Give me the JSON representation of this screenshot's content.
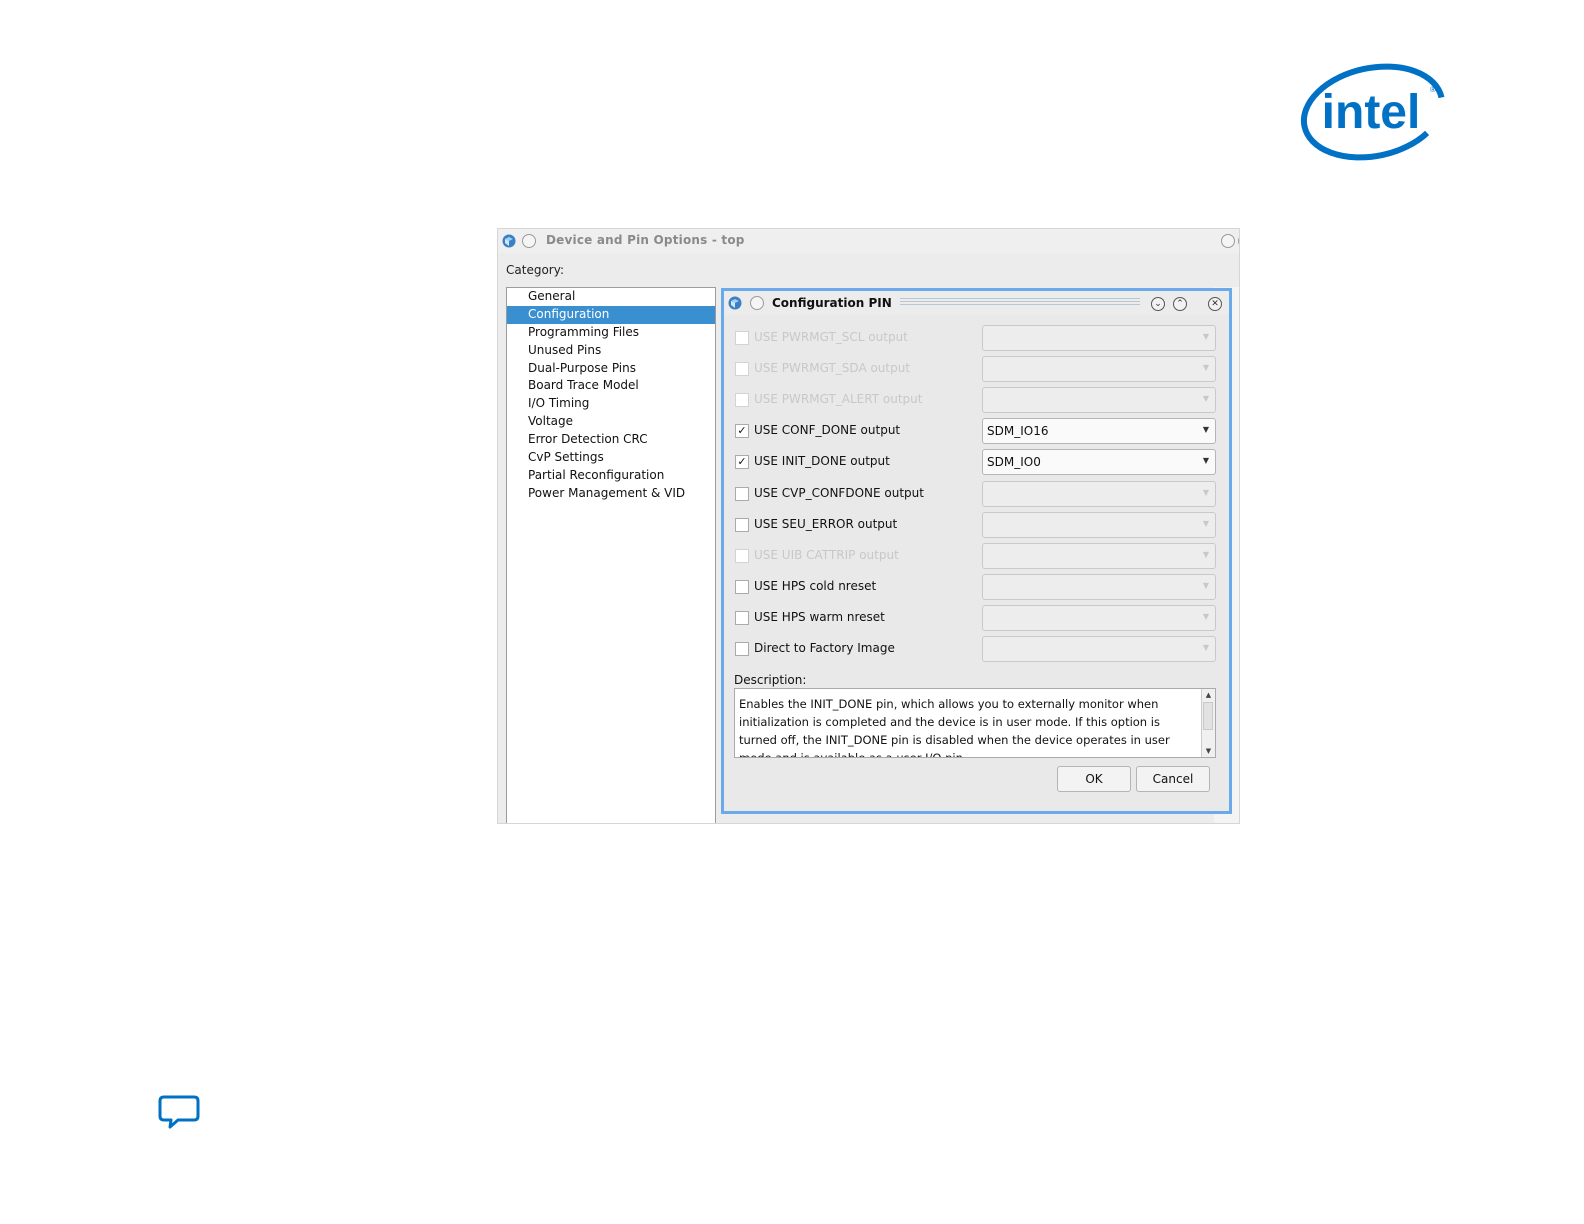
{
  "brand": {
    "logo_text": "intel",
    "logo_color": "#0071c5"
  },
  "outer_window": {
    "title": "Device and Pin Options - top",
    "category_label": "Category:",
    "categories": [
      "General",
      "Configuration",
      "Programming Files",
      "Unused Pins",
      "Dual-Purpose Pins",
      "Board Trace Model",
      "I/O Timing",
      "Voltage",
      "Error Detection CRC",
      "CvP Settings",
      "Partial Reconfiguration",
      "Power Management & VID"
    ],
    "selected_category": "Configuration"
  },
  "dialog": {
    "title": "Configuration PIN",
    "rows": [
      {
        "label": "USE PWRMGT_SCL output",
        "checked": false,
        "enabled": false,
        "value": ""
      },
      {
        "label": "USE PWRMGT_SDA output",
        "checked": false,
        "enabled": false,
        "value": ""
      },
      {
        "label": "USE PWRMGT_ALERT output",
        "checked": false,
        "enabled": false,
        "value": ""
      },
      {
        "label": "USE CONF_DONE output",
        "checked": true,
        "enabled": true,
        "value": "SDM_IO16"
      },
      {
        "label": "USE INIT_DONE output",
        "checked": true,
        "enabled": true,
        "value": "SDM_IO0"
      },
      {
        "label": "USE CVP_CONFDONE output",
        "checked": false,
        "enabled": true,
        "value": ""
      },
      {
        "label": "USE SEU_ERROR output",
        "checked": false,
        "enabled": true,
        "value": ""
      },
      {
        "label": "USE UIB CATTRIP output",
        "checked": false,
        "enabled": false,
        "value": ""
      },
      {
        "label": "USE HPS cold nreset",
        "checked": false,
        "enabled": true,
        "value": ""
      },
      {
        "label": "USE HPS warm nreset",
        "checked": false,
        "enabled": true,
        "value": ""
      },
      {
        "label": "Direct to Factory Image",
        "checked": false,
        "enabled": true,
        "value": ""
      }
    ],
    "description_label": "Description:",
    "description_text": "Enables the INIT_DONE pin, which allows you to externally monitor when initialization is completed and the device is in user mode. If this option is turned off, the INIT_DONE pin is disabled when the device operates in user mode and is available as a user I/O pin.",
    "ok_label": "OK",
    "cancel_label": "Cancel"
  }
}
